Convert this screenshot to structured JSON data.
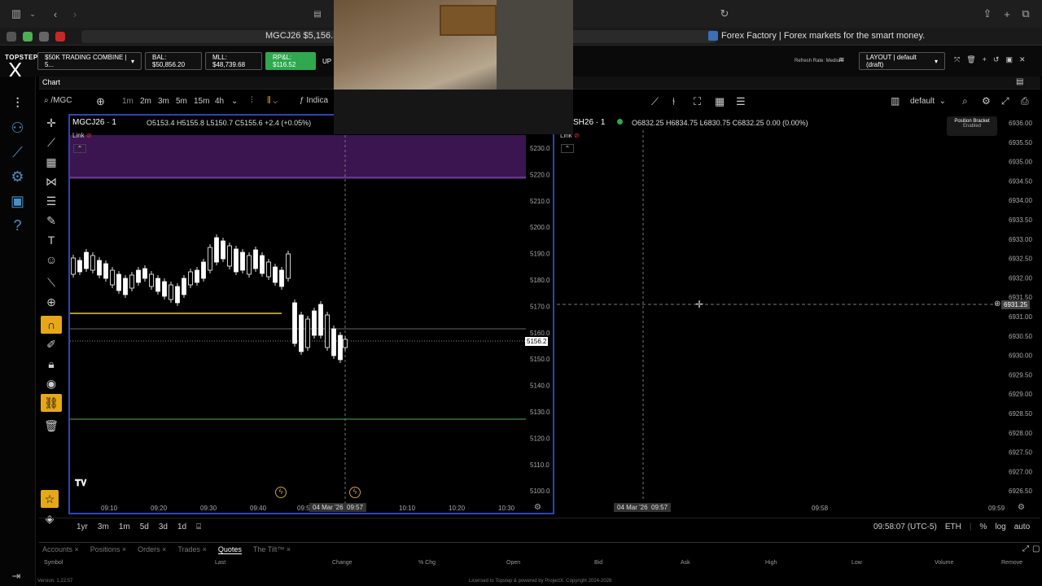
{
  "browser": {
    "tab_left": "MGCJ26 $5,156.3",
    "tab_right": "Forex Factory | Forex markets for the smart money."
  },
  "header": {
    "logo_top": "TOPSTEP",
    "logo_big": "X",
    "account": "$50K TRADING COMBINE | 5...",
    "bal": "BAL: $50,856.20",
    "mll": "MLL: $48,739.68",
    "rpl": "RP&L: $116.52",
    "upl": "UP",
    "refresh": "Refresh Rate: Medium",
    "layout": "LAYOUT | default (draft)"
  },
  "chart_tab": {
    "label": "Chart"
  },
  "toolbar": {
    "symbol": "/MGC",
    "timeframes": [
      "1m",
      "2m",
      "3m",
      "5m",
      "15m",
      "4h"
    ],
    "indicators": "Indica",
    "layout_name": "default"
  },
  "left_chart": {
    "title": "MGCJ26 · 1",
    "ohlc": "O5153.4  H5155.8  L5150.7  C5155.6  +2.4 (+0.05%)",
    "link": "Link",
    "last_price": "5156.2",
    "crosshair_date": "04 Mar '26",
    "crosshair_time": "09:57",
    "price_ticks": [
      "5230.0",
      "5220.0",
      "5210.0",
      "5200.0",
      "5190.0",
      "5180.0",
      "5170.0",
      "5160.0",
      "5150.0",
      "5140.0",
      "5130.0",
      "5120.0",
      "5110.0",
      "5100.0"
    ],
    "time_ticks": [
      "09:10",
      "09:20",
      "09:30",
      "09:40",
      "09:5",
      "10:10",
      "10:20",
      "10:30"
    ]
  },
  "right_chart": {
    "title": "SH26 · 1",
    "ohlc": "O6832.25  H6834.75  L6830.75  C6832.25  0.00 (0.00%)",
    "link": "Link",
    "crosshair_price": "6931.25",
    "crosshair_date": "04 Mar '26",
    "crosshair_time": "09:57",
    "badge_title": "Position Bracket",
    "badge_sub": "Enabled",
    "price_ticks": [
      "6936.00",
      "6935.50",
      "6935.00",
      "6934.50",
      "6934.00",
      "6933.50",
      "6933.00",
      "6932.50",
      "6932.00",
      "6931.50",
      "6931.00",
      "6930.50",
      "6930.00",
      "6929.50",
      "6929.00",
      "6928.50",
      "6928.00",
      "6927.50",
      "6927.00",
      "6926.50"
    ],
    "time_ticks": [
      "09:58",
      "09:59"
    ]
  },
  "bottom_bar": {
    "ranges": [
      "1yr",
      "3m",
      "1m",
      "5d",
      "3d",
      "1d"
    ],
    "clock": "09:58:07 (UTC-5)",
    "session": "ETH",
    "pct": "%",
    "log": "log",
    "auto": "auto"
  },
  "bottom_tabs": [
    "Accounts",
    "Positions",
    "Orders",
    "Trades",
    "Quotes",
    "The Tilt™"
  ],
  "quote_headers": [
    "Symbol",
    "Last",
    "Change",
    "% Chg",
    "Open",
    "Bid",
    "Ask",
    "High",
    "Low",
    "Volume",
    "Remove"
  ],
  "footer": "Licensed to Topstep & powered by ProjectX. Copyright 2024-2026",
  "version": "Version: 1.22.57",
  "colors": {
    "accent_blue": "#2b45b8",
    "green": "#2fa84f",
    "yellow": "#e6a817",
    "purple": "#3a1550"
  }
}
